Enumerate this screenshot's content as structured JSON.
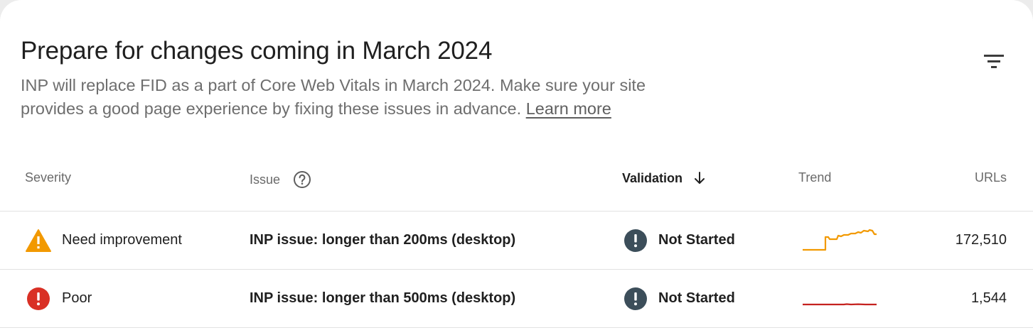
{
  "header": {
    "title": "Prepare for changes coming in March 2024",
    "description": "INP will replace FID as a part of Core Web Vitals in March 2024. Make sure your site provides a good page experience by fixing these issues in advance.",
    "learn_more": "Learn more"
  },
  "table": {
    "columns": {
      "severity": "Severity",
      "issue": "Issue",
      "validation": "Validation",
      "trend": "Trend",
      "urls": "URLs"
    },
    "sorted_column": "validation",
    "rows": [
      {
        "severity": "Need improvement",
        "severity_icon": "warning-icon",
        "severity_color": "#f29900",
        "issue": "INP issue: longer than 200ms (desktop)",
        "validation": "Not Started",
        "validation_icon": "exclamation-circle-icon",
        "trend_color": "#f29900",
        "urls": "172,510"
      },
      {
        "severity": "Poor",
        "severity_icon": "error-icon",
        "severity_color": "#d93025",
        "issue": "INP issue: longer than 500ms (desktop)",
        "validation": "Not Started",
        "validation_icon": "exclamation-circle-icon",
        "trend_color": "#c5221f",
        "urls": "1,544"
      }
    ]
  }
}
